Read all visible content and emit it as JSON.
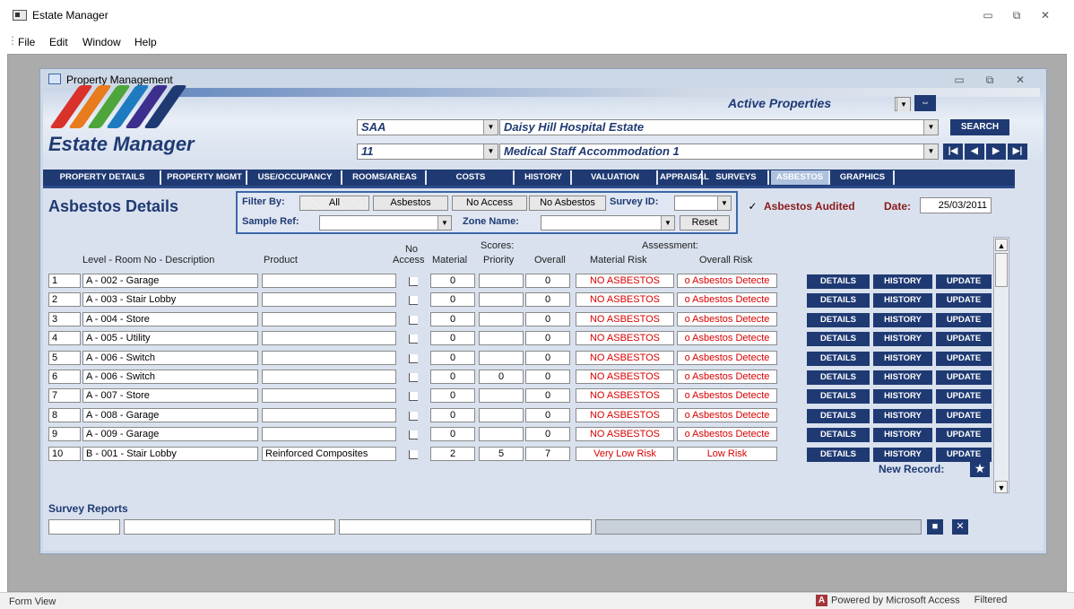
{
  "app": {
    "title": "Estate Manager",
    "window_buttons": [
      "▭",
      "⧉",
      "✕"
    ]
  },
  "menu": [
    {
      "label": "File"
    },
    {
      "label": "Edit"
    },
    {
      "label": "Window"
    },
    {
      "label": "Help"
    }
  ],
  "child": {
    "title": "Property Management",
    "window_buttons": [
      "▭",
      "⧉",
      "✕"
    ]
  },
  "logo": {
    "text": "Estate Manager",
    "stripe_colors": [
      "#d9322b",
      "#e77b1e",
      "#4ea53b",
      "#1f7bc0",
      "#3d2f8e",
      "#1f3a73"
    ]
  },
  "header": {
    "status_combo": "Active Properties",
    "site_code": "SAA",
    "site_name": "Daisy Hill Hospital Estate",
    "property_code": "11",
    "property_name": "Medical Staff Accommodation 1",
    "search_label": "SEARCH",
    "nav": {
      "first": "|◀",
      "prev": "◀",
      "next": "▶",
      "last": "▶|"
    }
  },
  "tabs": [
    {
      "label": "PROPERTY DETAILS",
      "active": false
    },
    {
      "label": "PROPERTY MGMT",
      "active": false
    },
    {
      "label": "USE/OCCUPANCY",
      "active": false
    },
    {
      "label": "ROOMS/AREAS",
      "active": false
    },
    {
      "label": "COSTS",
      "active": false
    },
    {
      "label": "HISTORY",
      "active": false
    },
    {
      "label": "VALUATION",
      "active": false
    },
    {
      "label": "APPRAISAL",
      "active": false
    },
    {
      "label": "SURVEYS",
      "active": false
    },
    {
      "label": "ASBESTOS",
      "active": true
    },
    {
      "label": "GRAPHICS",
      "active": false
    }
  ],
  "panel": {
    "title": "Asbestos Details",
    "filter_label": "Filter By:",
    "filter_buttons": [
      "All",
      "Asbestos",
      "No Access",
      "No Asbestos"
    ],
    "survey_id_label": "Survey ID:",
    "sample_ref_label": "Sample Ref:",
    "zone_name_label": "Zone Name:",
    "reset_label": "Reset",
    "audited_label": "Asbestos Audited",
    "audited_checked": true,
    "date_label": "Date:",
    "date_value": "25/03/2011"
  },
  "table": {
    "headers": {
      "level_room": "Level - Room No - Description",
      "product": "Product",
      "no_access_1": "No",
      "no_access_2": "Access",
      "scores": "Scores:",
      "material": "Material",
      "priority": "Priority",
      "overall": "Overall",
      "assessment": "Assessment:",
      "material_risk": "Material Risk",
      "overall_risk": "Overall Risk"
    },
    "buttons": {
      "details": "DETAILS",
      "history": "HISTORY",
      "update": "UPDATE"
    },
    "rows": [
      {
        "num": "1",
        "room": "A - 002 - Garage",
        "product": "",
        "material": "0",
        "priority": "",
        "overall": "0",
        "material_risk": "NO ASBESTOS",
        "overall_risk": "o Asbestos Detecte"
      },
      {
        "num": "2",
        "room": "A - 003 - Stair Lobby",
        "product": "",
        "material": "0",
        "priority": "",
        "overall": "0",
        "material_risk": "NO ASBESTOS",
        "overall_risk": "o Asbestos Detecte"
      },
      {
        "num": "3",
        "room": "A - 004 - Store",
        "product": "",
        "material": "0",
        "priority": "",
        "overall": "0",
        "material_risk": "NO ASBESTOS",
        "overall_risk": "o Asbestos Detecte"
      },
      {
        "num": "4",
        "room": "A - 005 - Utility",
        "product": "",
        "material": "0",
        "priority": "",
        "overall": "0",
        "material_risk": "NO ASBESTOS",
        "overall_risk": "o Asbestos Detecte"
      },
      {
        "num": "5",
        "room": "A - 006 - Switch",
        "product": "",
        "material": "0",
        "priority": "",
        "overall": "0",
        "material_risk": "NO ASBESTOS",
        "overall_risk": "o Asbestos Detecte"
      },
      {
        "num": "6",
        "room": "A - 006 - Switch",
        "product": "",
        "material": "0",
        "priority": "0",
        "overall": "0",
        "material_risk": "NO ASBESTOS",
        "overall_risk": "o Asbestos Detecte"
      },
      {
        "num": "7",
        "room": "A - 007 - Store",
        "product": "",
        "material": "0",
        "priority": "",
        "overall": "0",
        "material_risk": "NO ASBESTOS",
        "overall_risk": "o Asbestos Detecte"
      },
      {
        "num": "8",
        "room": "A - 008 - Garage",
        "product": "",
        "material": "0",
        "priority": "",
        "overall": "0",
        "material_risk": "NO ASBESTOS",
        "overall_risk": "o Asbestos Detecte"
      },
      {
        "num": "9",
        "room": "A - 009 - Garage",
        "product": "",
        "material": "0",
        "priority": "",
        "overall": "0",
        "material_risk": "NO ASBESTOS",
        "overall_risk": "o Asbestos Detecte"
      },
      {
        "num": "10",
        "room": "B - 001 - Stair Lobby",
        "product": "Reinforced Composites",
        "material": "2",
        "priority": "5",
        "overall": "7",
        "material_risk": "Very Low Risk",
        "overall_risk": "Low Risk"
      }
    ]
  },
  "new_record": {
    "label": "New Record:",
    "icon": "★"
  },
  "survey_reports": {
    "label": "Survey Reports"
  },
  "statusbar": {
    "left": "Form View",
    "powered": "Powered by Microsoft Access",
    "filter_state": "Filtered",
    "access_icon": "A"
  }
}
